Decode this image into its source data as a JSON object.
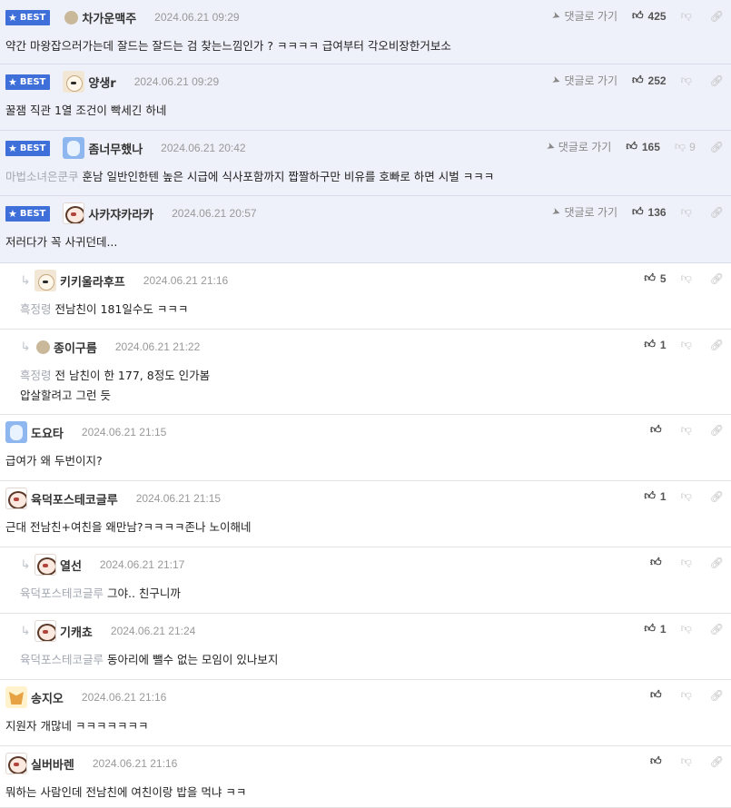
{
  "comments": [
    {
      "best": true,
      "badge": "BEST",
      "nickname": "차가운맥주",
      "date": "2024.06.21 09:29",
      "mention": "",
      "text": [
        "약간 마왕잡으러가는데 잘드는 잘드는 검 찾는느낌인가 ? ㅋㅋㅋㅋ 급여부터 각오비장한거보소"
      ],
      "reply_label": "댓글로 가기",
      "likes": "425",
      "dislikes": "",
      "avatar": "dot-avatar"
    },
    {
      "best": true,
      "badge": "BEST",
      "nickname": "양생r",
      "date": "2024.06.21 09:29",
      "mention": "",
      "text": [
        "꿀잼 직관 1열 조건이 빡세긴 하네"
      ],
      "reply_label": "댓글로 가기",
      "likes": "252",
      "dislikes": "",
      "avatar": "dog-avatar"
    },
    {
      "best": true,
      "badge": "BEST",
      "nickname": "좀너무했나",
      "date": "2024.06.21 20:42",
      "mention": "마법소녀은쿤쿠",
      "text": [
        "훈남 일반인한텐 높은 시급에 식사포함까지 짭짤하구만 비유를 호빠로 하면 시벌 ㅋㅋㅋ"
      ],
      "reply_label": "댓글로 가기",
      "likes": "165",
      "dislikes": "9",
      "avatar": "blue-avatar"
    },
    {
      "best": true,
      "badge": "BEST",
      "nickname": "사카쟈카라카",
      "date": "2024.06.21 20:57",
      "mention": "",
      "text": [
        "저러다가 꼭 사귀던데..."
      ],
      "reply_label": "댓글로 가기",
      "likes": "136",
      "dislikes": "",
      "avatar": "panda-avatar"
    },
    {
      "reply": true,
      "nickname": "키키울라후프",
      "date": "2024.06.21 21:16",
      "mention": "흑정령",
      "text": [
        "전남친이 181일수도 ㅋㅋㅋ"
      ],
      "likes": "5",
      "dislikes": "",
      "avatar": "dog-avatar"
    },
    {
      "reply": true,
      "nickname": "종이구름",
      "date": "2024.06.21 21:22",
      "mention": "흑정령",
      "text": [
        "전 남친이 한 177, 8정도 인가봄",
        "압살할려고 그런 듯"
      ],
      "likes": "1",
      "dislikes": "",
      "avatar": "dot-avatar"
    },
    {
      "nickname": "도요타",
      "date": "2024.06.21 21:15",
      "mention": "",
      "text": [
        "급여가 왜 두번이지?"
      ],
      "likes": "",
      "dislikes": "",
      "avatar": "blue-avatar"
    },
    {
      "nickname": "육덕포스테코글루",
      "date": "2024.06.21 21:15",
      "mention": "",
      "text": [
        "근대 전남친+여친을 왜만남?ㅋㅋㅋㅋ존나 노이해네"
      ],
      "likes": "1",
      "dislikes": "",
      "avatar": "panda-avatar"
    },
    {
      "reply": true,
      "nickname": "열선",
      "date": "2024.06.21 21:17",
      "mention": "육덕포스테코글루",
      "text": [
        "그야.. 친구니까"
      ],
      "likes": "",
      "dislikes": "",
      "avatar": "panda-avatar"
    },
    {
      "reply": true,
      "nickname": "기캐쵸",
      "date": "2024.06.21 21:24",
      "mention": "육덕포스테코글루",
      "text": [
        "동아리에 뺄수 없는 모임이 있나보지"
      ],
      "likes": "1",
      "dislikes": "",
      "avatar": "panda-avatar"
    },
    {
      "nickname": "송지오",
      "date": "2024.06.21 21:16",
      "mention": "",
      "text": [
        "지원자 개많네 ㅋㅋㅋㅋㅋㅋㅋ"
      ],
      "likes": "",
      "dislikes": "",
      "avatar": "fox-avatar"
    },
    {
      "nickname": "실버바렌",
      "date": "2024.06.21 21:16",
      "mention": "",
      "text": [
        "뭐하는 사람인데 전남친에 여친이랑 밥을 먹냐 ㅋㅋ"
      ],
      "likes": "",
      "dislikes": "",
      "avatar": "panda-avatar"
    }
  ]
}
